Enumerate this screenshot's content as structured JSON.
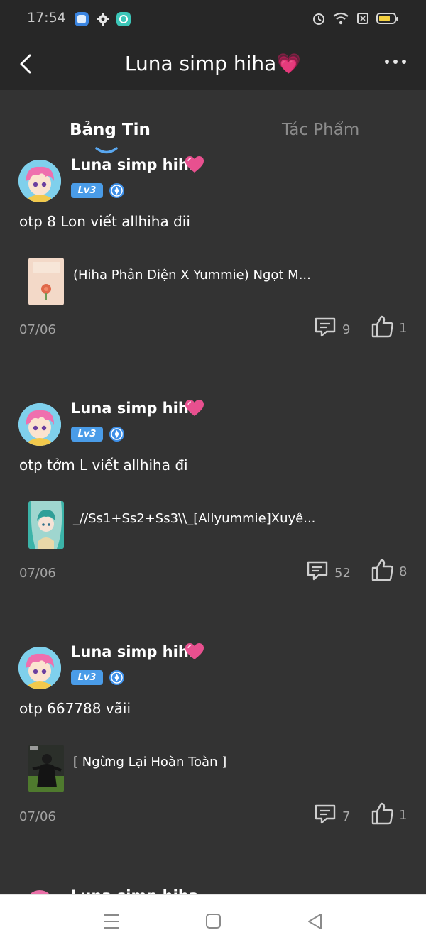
{
  "status_bar": {
    "time": "17:54",
    "left_icons": [
      "blue-app-icon",
      "gear-app-icon",
      "teal-app-icon"
    ],
    "right_icons": [
      "alarm-icon",
      "wifi-icon",
      "sim-icon",
      "battery-icon"
    ]
  },
  "header": {
    "title": "Luna simp hiha💗",
    "back_icon": "chevron-left-icon",
    "more_icon": "more-dots-icon"
  },
  "tabs": [
    {
      "label": "Bảng Tin",
      "active": true
    },
    {
      "label": "Tác Phẩm",
      "active": false
    }
  ],
  "posts": [
    {
      "author": "Luna simp hiha",
      "level": "Lv3",
      "text": "otp 8 Lon viết allhiha đii",
      "book_title": "(Hiha Phản Diện X Yummie) Ngọt M...",
      "date": "07/06",
      "comments": "9",
      "likes": "1"
    },
    {
      "author": "Luna simp hiha",
      "level": "Lv3",
      "text": "otp tởm L viết allhiha đi",
      "book_title": "_//Ss1+Ss2+Ss3\\\\_[Allyummie]Xuyê...",
      "date": "07/06",
      "comments": "52",
      "likes": "8"
    },
    {
      "author": "Luna simp hiha",
      "level": "Lv3",
      "text": "otp 667788 vãii",
      "book_title": "[ Ngừng Lại Hoàn Toàn ]",
      "date": "07/06",
      "comments": "7",
      "likes": "1"
    }
  ],
  "partial_post": {
    "author": "Luna simp hiha"
  },
  "nav": {
    "menu_icon": "menu-icon",
    "home_icon": "square-home-icon",
    "back_icon": "triangle-back-icon"
  },
  "colors": {
    "background": "#333333",
    "bar": "#272727",
    "badge": "#4a9ce8",
    "secondary_text": "#a3a3a3"
  }
}
